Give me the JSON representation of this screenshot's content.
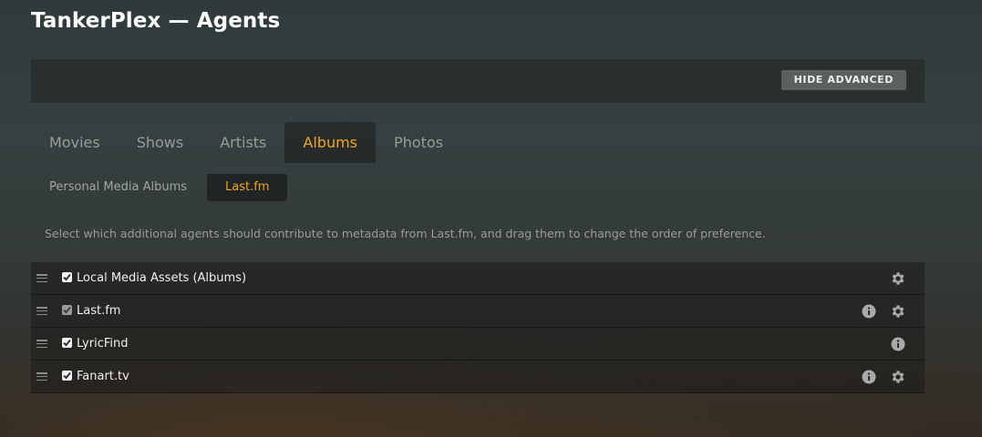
{
  "app": {
    "title": "TankerPlex — Agents"
  },
  "settings_bar": {
    "hide_advanced_label": "HIDE ADVANCED"
  },
  "tabs": [
    {
      "label": "Movies",
      "active": false
    },
    {
      "label": "Shows",
      "active": false
    },
    {
      "label": "Artists",
      "active": false
    },
    {
      "label": "Albums",
      "active": true
    },
    {
      "label": "Photos",
      "active": false
    }
  ],
  "subtabs": [
    {
      "label": "Personal Media Albums",
      "active": false
    },
    {
      "label": "Last.fm",
      "active": true
    }
  ],
  "description": "Select which additional agents should contribute to metadata from Last.fm, and drag them to change the order of preference.",
  "agents": [
    {
      "name": "Local Media Assets (Albums)",
      "checked": true,
      "disabled": false,
      "info": false,
      "settings": true
    },
    {
      "name": "Last.fm",
      "checked": true,
      "disabled": true,
      "info": true,
      "settings": true
    },
    {
      "name": "LyricFind",
      "checked": true,
      "disabled": false,
      "info": true,
      "settings": false
    },
    {
      "name": "Fanart.tv",
      "checked": true,
      "disabled": false,
      "info": true,
      "settings": true
    }
  ],
  "icons": {
    "drag": "drag-handle-icon",
    "check": "checkmark-icon",
    "info": "info-icon",
    "settings": "gear-icon"
  },
  "colors": {
    "accent": "#f0a520",
    "muted_text": "#9a9c9c",
    "button_bg": "#5b5f5f"
  }
}
